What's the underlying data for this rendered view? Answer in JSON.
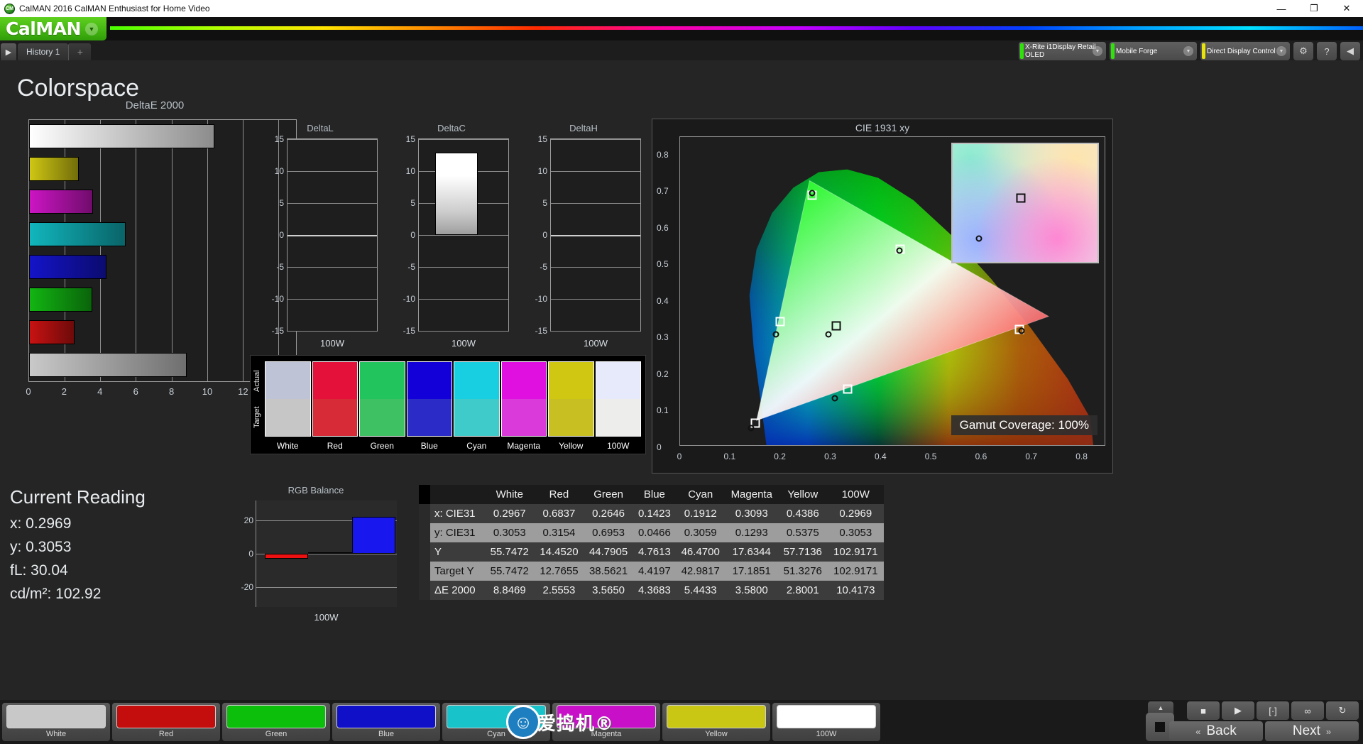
{
  "window": {
    "title": "CalMAN 2016 CalMAN Enthusiast for Home Video",
    "app_icon": "calman-logo-icon",
    "minimize": "—",
    "maximize": "❐",
    "close": "✕"
  },
  "header": {
    "logo_text": "CalMAN",
    "logo_caret": "▼"
  },
  "tabs": {
    "arrow": "▶",
    "items": [
      {
        "label": "History 1"
      }
    ],
    "add_label": "+"
  },
  "devices": [
    {
      "name": "meter-selector",
      "line1": "X-Rite i1Display Retail",
      "line2": "OLED",
      "status_color": "#2fe20a",
      "caret": "▼"
    },
    {
      "name": "source-selector",
      "line1": "Mobile Forge",
      "line2": "",
      "status_color": "#2fe20a",
      "caret": "▼"
    },
    {
      "name": "display-control-selector",
      "line1": "Direct Display Control",
      "line2": "",
      "status_color": "#e8e30a",
      "caret": "▼"
    }
  ],
  "toolbar_icons": [
    {
      "name": "settings-gear-icon",
      "glyph": "⚙"
    },
    {
      "name": "help-icon",
      "glyph": "?"
    },
    {
      "name": "collapse-icon",
      "glyph": "◀"
    }
  ],
  "page_title": "Colorspace",
  "chart_data": [
    {
      "type": "bar",
      "name": "deltae-2000",
      "title": "DeltaE 2000",
      "orientation": "horizontal",
      "categories": [
        "100W",
        "Yellow",
        "Magenta",
        "Cyan",
        "Blue",
        "Green",
        "Red",
        "White"
      ],
      "values": [
        10.4173,
        2.8001,
        3.58,
        5.4433,
        4.3683,
        3.565,
        2.5553,
        8.8469
      ],
      "colors": [
        "#ffffff",
        "#cfc713",
        "#cc15c4",
        "#11b6bd",
        "#1414c9",
        "#12b512",
        "#c81212",
        "#c9c9c9"
      ],
      "xlabel": "",
      "ylabel": "",
      "xlim": [
        0,
        15
      ],
      "xticks": [
        0,
        2,
        4,
        6,
        8,
        10,
        12,
        14
      ],
      "grid": true
    },
    {
      "type": "bar",
      "name": "delta-l",
      "title": "DeltaL",
      "categories": [
        "100W"
      ],
      "values": [
        0.0
      ],
      "ylim": [
        -15,
        15
      ],
      "yticks": [
        15,
        10,
        5,
        0,
        -5,
        -10,
        -15
      ],
      "xlabel": "100W",
      "grid": true
    },
    {
      "type": "bar",
      "name": "delta-c",
      "title": "DeltaC",
      "categories": [
        "100W"
      ],
      "values": [
        12.9
      ],
      "ylim": [
        -15,
        15
      ],
      "yticks": [
        15,
        10,
        5,
        0,
        -5,
        -10,
        -15
      ],
      "xlabel": "100W",
      "grid": true
    },
    {
      "type": "bar",
      "name": "delta-h",
      "title": "DeltaH",
      "categories": [
        "100W"
      ],
      "values": [
        0.0
      ],
      "ylim": [
        -15,
        15
      ],
      "yticks": [
        15,
        10,
        5,
        0,
        -5,
        -10,
        -15
      ],
      "xlabel": "100W",
      "grid": true
    },
    {
      "type": "bar",
      "name": "rgb-balance",
      "title": "RGB Balance",
      "categories": [
        "Red",
        "Green",
        "Blue"
      ],
      "values": [
        -3,
        0,
        22
      ],
      "colors": [
        "#ee1111",
        "#11bb11",
        "#1717ee"
      ],
      "ylim": [
        -32,
        32
      ],
      "yticks": [
        20,
        0,
        -20
      ],
      "xlabel": "100W",
      "grid": true
    },
    {
      "type": "scatter",
      "name": "cie-1931-xy",
      "title": "CIE 1931 xy",
      "xlabel": "",
      "ylabel": "",
      "xlim": [
        0,
        0.85
      ],
      "ylim": [
        0,
        0.85
      ],
      "xticks": [
        0,
        0.1,
        0.2,
        0.3,
        0.4,
        0.5,
        0.6,
        0.7,
        0.8
      ],
      "yticks": [
        0,
        0.1,
        0.2,
        0.3,
        0.4,
        0.5,
        0.6,
        0.7,
        0.8
      ],
      "annotation": "Gamut Coverage:  100%",
      "series": [
        {
          "name": "Target",
          "marker": "square",
          "points": [
            {
              "label": "White",
              "x": 0.3127,
              "y": 0.329
            },
            {
              "label": "Red",
              "x": 0.68,
              "y": 0.32
            },
            {
              "label": "Green",
              "x": 0.265,
              "y": 0.69
            },
            {
              "label": "Blue",
              "x": 0.15,
              "y": 0.06
            },
            {
              "label": "Cyan",
              "x": 0.2,
              "y": 0.34
            },
            {
              "label": "Magenta",
              "x": 0.335,
              "y": 0.154
            },
            {
              "label": "Yellow",
              "x": 0.44,
              "y": 0.54
            }
          ]
        },
        {
          "name": "Measured",
          "marker": "circle",
          "points": [
            {
              "label": "White",
              "x": 0.2967,
              "y": 0.3053
            },
            {
              "label": "Red",
              "x": 0.6837,
              "y": 0.3154
            },
            {
              "label": "Green",
              "x": 0.2646,
              "y": 0.6953
            },
            {
              "label": "Blue",
              "x": 0.1423,
              "y": 0.0466
            },
            {
              "label": "Cyan",
              "x": 0.1912,
              "y": 0.3059
            },
            {
              "label": "Magenta",
              "x": 0.3093,
              "y": 0.1293
            },
            {
              "label": "Yellow",
              "x": 0.4386,
              "y": 0.5375
            }
          ]
        }
      ]
    }
  ],
  "gamut_coverage": "Gamut Coverage:  100%",
  "swatch_panel": {
    "actual_label": "Actual",
    "target_label": "Target",
    "items": [
      {
        "label": "White",
        "actual": "#bec4d6",
        "target": "#c6c6c6"
      },
      {
        "label": "Red",
        "actual": "#e4123a",
        "target": "#d72b38"
      },
      {
        "label": "Green",
        "actual": "#22c45e",
        "target": "#3ec163"
      },
      {
        "label": "Blue",
        "actual": "#1300d8",
        "target": "#2b2bc8"
      },
      {
        "label": "Cyan",
        "actual": "#17cfe0",
        "target": "#40cbcb"
      },
      {
        "label": "Magenta",
        "actual": "#e010e0",
        "target": "#da3ada"
      },
      {
        "label": "Yellow",
        "actual": "#cfc712",
        "target": "#c8c022"
      },
      {
        "label": "100W",
        "actual": "#e7eafb",
        "target": "#ededeb"
      }
    ]
  },
  "current_reading": {
    "title": "Current Reading",
    "x": "x: 0.2969",
    "y": "y: 0.3053",
    "fl": "fL: 30.04",
    "cd": "cd/m²: 102.92"
  },
  "data_table": {
    "columns": [
      "White",
      "Red",
      "Green",
      "Blue",
      "Cyan",
      "Magenta",
      "Yellow",
      "100W"
    ],
    "rows": [
      {
        "label": "x: CIE31",
        "values": [
          "0.2967",
          "0.6837",
          "0.2646",
          "0.1423",
          "0.1912",
          "0.3093",
          "0.4386",
          "0.2969"
        ]
      },
      {
        "label": "y: CIE31",
        "values": [
          "0.3053",
          "0.3154",
          "0.6953",
          "0.0466",
          "0.3059",
          "0.1293",
          "0.5375",
          "0.3053"
        ]
      },
      {
        "label": "Y",
        "values": [
          "55.7472",
          "14.4520",
          "44.7905",
          "4.7613",
          "46.4700",
          "17.6344",
          "57.7136",
          "102.9171"
        ]
      },
      {
        "label": "Target Y",
        "values": [
          "55.7472",
          "12.7655",
          "38.5621",
          "4.4197",
          "42.9817",
          "17.1851",
          "51.3276",
          "102.9171"
        ]
      },
      {
        "label": "ΔE 2000",
        "values": [
          "8.8469",
          "2.5553",
          "3.5650",
          "4.3683",
          "5.4433",
          "3.5800",
          "2.8001",
          "10.4173"
        ]
      }
    ]
  },
  "bottom_buttons": [
    {
      "label": "White",
      "color": "#c8c8c8"
    },
    {
      "label": "Red",
      "color": "#c40d0d"
    },
    {
      "label": "Green",
      "color": "#0bbf0b"
    },
    {
      "label": "Blue",
      "color": "#1010c9"
    },
    {
      "label": "Cyan",
      "color": "#18c4c9"
    },
    {
      "label": "Magenta",
      "color": "#c810c8"
    },
    {
      "label": "Yellow",
      "color": "#c9c714"
    },
    {
      "label": "100W",
      "color": "#ffffff"
    }
  ],
  "nav": {
    "icons": [
      {
        "name": "stop-icon",
        "glyph": "■"
      },
      {
        "name": "play-icon",
        "glyph": "▶"
      },
      {
        "name": "bracket-icon",
        "glyph": "[·]"
      },
      {
        "name": "loop-icon",
        "glyph": "∞"
      },
      {
        "name": "refresh-icon",
        "glyph": "↻"
      }
    ],
    "up_arrow": "▲",
    "stop_big": "stop-square-icon",
    "back_label": "Back",
    "next_label": "Next",
    "back_chevron": "«",
    "next_chevron": "»"
  },
  "watermark": {
    "text": "爱捣机®"
  }
}
